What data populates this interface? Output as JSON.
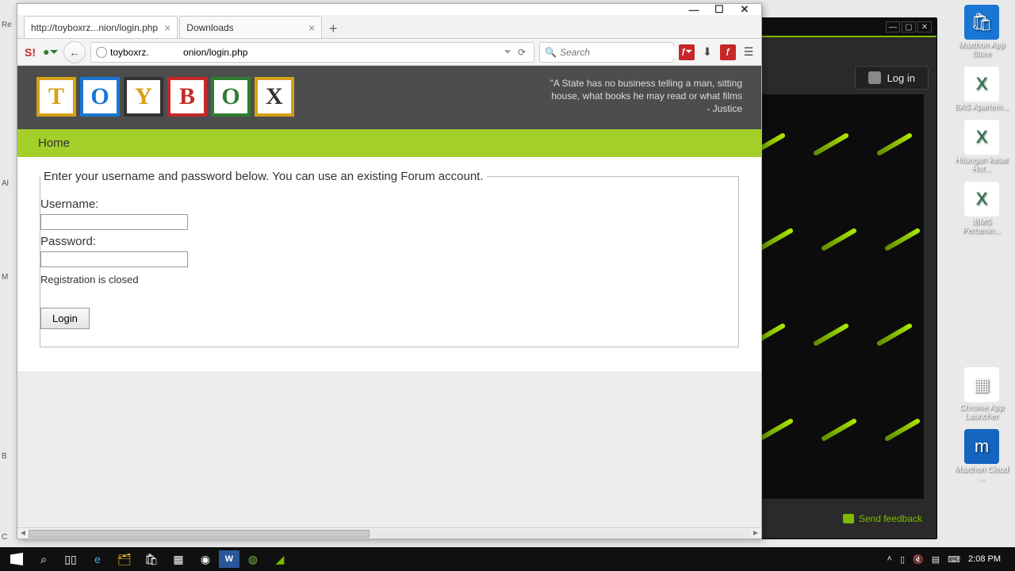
{
  "desktop": {
    "icons": [
      {
        "label": "Maxthon App Store",
        "kind": "blue",
        "glyph": "🛍"
      },
      {
        "label": "BAS Apartem...",
        "kind": "xl",
        "glyph": "X"
      },
      {
        "label": "Hitungan kasar Hot...",
        "kind": "xl",
        "glyph": "X"
      },
      {
        "label": "IBMS Pertamin...",
        "kind": "xl",
        "glyph": "X"
      },
      {
        "label": "Chrome App Launcher",
        "kind": "plain",
        "glyph": "▦"
      },
      {
        "label": "Maxthon Cloud ...",
        "kind": "mx",
        "glyph": "m"
      }
    ]
  },
  "back_window": {
    "login_label": "Log in",
    "feedback": "Send feedback"
  },
  "firefox": {
    "tabs": [
      {
        "title": "http://toyboxrz...nion/login.php",
        "active": true
      },
      {
        "title": "Downloads",
        "active": false
      }
    ],
    "url_display": "toyboxrz.             onion/login.php",
    "search_placeholder": "Search"
  },
  "page": {
    "logo_letters": [
      "T",
      "O",
      "Y",
      "B",
      "O",
      "X"
    ],
    "quote_line1": "\"A State has no business telling a man, sitting",
    "quote_line2": "house, what books he may read or what films",
    "quote_line3": "- Justice",
    "nav_home": "Home",
    "legend": "Enter your username and password below. You can use an existing Forum account.",
    "username_label": "Username:",
    "password_label": "Password:",
    "reg_closed": "Registration is closed",
    "login_button": "Login"
  },
  "taskbar": {
    "time": "2:08 PM"
  }
}
